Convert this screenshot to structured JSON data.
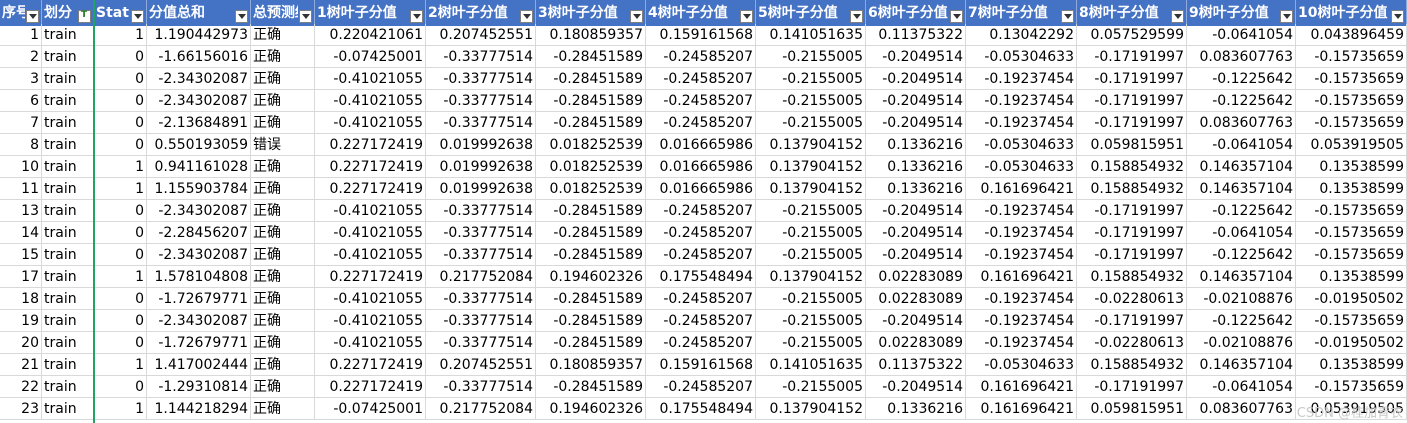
{
  "headers": [
    "序号",
    "划分",
    "Statu",
    "分值总和",
    "总预测结",
    "1树叶子分值",
    "2树叶子分值",
    "3树叶子分值",
    "4树叶子分值",
    "5树叶子分值",
    "6树叶子分值",
    "7树叶子分值",
    "8树叶子分值",
    "9树叶子分值",
    "10树叶子分值"
  ],
  "rows": [
    [
      "1",
      "train",
      "1",
      "1.190442973",
      "正确",
      "0.220421061",
      "0.207452551",
      "0.180859357",
      "0.159161568",
      "0.141051635",
      "0.11375322",
      "0.13042292",
      "0.057529599",
      "-0.0641054",
      "0.043896459"
    ],
    [
      "2",
      "train",
      "0",
      "-1.66156016",
      "正确",
      "-0.07425001",
      "-0.33777514",
      "-0.28451589",
      "-0.24585207",
      "-0.2155005",
      "-0.2049514",
      "-0.05304633",
      "-0.17191997",
      "0.083607763",
      "-0.15735659"
    ],
    [
      "3",
      "train",
      "0",
      "-2.34302087",
      "正确",
      "-0.41021055",
      "-0.33777514",
      "-0.28451589",
      "-0.24585207",
      "-0.2155005",
      "-0.2049514",
      "-0.19237454",
      "-0.17191997",
      "-0.1225642",
      "-0.15735659"
    ],
    [
      "6",
      "train",
      "0",
      "-2.34302087",
      "正确",
      "-0.41021055",
      "-0.33777514",
      "-0.28451589",
      "-0.24585207",
      "-0.2155005",
      "-0.2049514",
      "-0.19237454",
      "-0.17191997",
      "-0.1225642",
      "-0.15735659"
    ],
    [
      "7",
      "train",
      "0",
      "-2.13684891",
      "正确",
      "-0.41021055",
      "-0.33777514",
      "-0.28451589",
      "-0.24585207",
      "-0.2155005",
      "-0.2049514",
      "-0.19237454",
      "-0.17191997",
      "0.083607763",
      "-0.15735659"
    ],
    [
      "8",
      "train",
      "0",
      "0.550193059",
      "错误",
      "0.227172419",
      "0.019992638",
      "0.018252539",
      "0.016665986",
      "0.137904152",
      "0.1336216",
      "-0.05304633",
      "0.059815951",
      "-0.0641054",
      "0.053919505"
    ],
    [
      "10",
      "train",
      "1",
      "0.941161028",
      "正确",
      "0.227172419",
      "0.019992638",
      "0.018252539",
      "0.016665986",
      "0.137904152",
      "0.1336216",
      "-0.05304633",
      "0.158854932",
      "0.146357104",
      "0.13538599"
    ],
    [
      "11",
      "train",
      "1",
      "1.155903784",
      "正确",
      "0.227172419",
      "0.019992638",
      "0.018252539",
      "0.016665986",
      "0.137904152",
      "0.1336216",
      "0.161696421",
      "0.158854932",
      "0.146357104",
      "0.13538599"
    ],
    [
      "13",
      "train",
      "0",
      "-2.34302087",
      "正确",
      "-0.41021055",
      "-0.33777514",
      "-0.28451589",
      "-0.24585207",
      "-0.2155005",
      "-0.2049514",
      "-0.19237454",
      "-0.17191997",
      "-0.1225642",
      "-0.15735659"
    ],
    [
      "14",
      "train",
      "0",
      "-2.28456207",
      "正确",
      "-0.41021055",
      "-0.33777514",
      "-0.28451589",
      "-0.24585207",
      "-0.2155005",
      "-0.2049514",
      "-0.19237454",
      "-0.17191997",
      "-0.0641054",
      "-0.15735659"
    ],
    [
      "15",
      "train",
      "0",
      "-2.34302087",
      "正确",
      "-0.41021055",
      "-0.33777514",
      "-0.28451589",
      "-0.24585207",
      "-0.2155005",
      "-0.2049514",
      "-0.19237454",
      "-0.17191997",
      "-0.1225642",
      "-0.15735659"
    ],
    [
      "17",
      "train",
      "1",
      "1.578104808",
      "正确",
      "0.227172419",
      "0.217752084",
      "0.194602326",
      "0.175548494",
      "0.137904152",
      "0.02283089",
      "0.161696421",
      "0.158854932",
      "0.146357104",
      "0.13538599"
    ],
    [
      "18",
      "train",
      "0",
      "-1.72679771",
      "正确",
      "-0.41021055",
      "-0.33777514",
      "-0.28451589",
      "-0.24585207",
      "-0.2155005",
      "0.02283089",
      "-0.19237454",
      "-0.02280613",
      "-0.02108876",
      "-0.01950502"
    ],
    [
      "19",
      "train",
      "0",
      "-2.34302087",
      "正确",
      "-0.41021055",
      "-0.33777514",
      "-0.28451589",
      "-0.24585207",
      "-0.2155005",
      "-0.2049514",
      "-0.19237454",
      "-0.17191997",
      "-0.1225642",
      "-0.15735659"
    ],
    [
      "20",
      "train",
      "0",
      "-1.72679771",
      "正确",
      "-0.41021055",
      "-0.33777514",
      "-0.28451589",
      "-0.24585207",
      "-0.2155005",
      "0.02283089",
      "-0.19237454",
      "-0.02280613",
      "-0.02108876",
      "-0.01950502"
    ],
    [
      "21",
      "train",
      "1",
      "1.417002444",
      "正确",
      "0.227172419",
      "0.207452551",
      "0.180859357",
      "0.159161568",
      "0.141051635",
      "0.11375322",
      "-0.05304633",
      "0.158854932",
      "0.146357104",
      "0.13538599"
    ],
    [
      "22",
      "train",
      "0",
      "-1.29310814",
      "正确",
      "0.227172419",
      "-0.33777514",
      "-0.28451589",
      "-0.24585207",
      "-0.2155005",
      "-0.2049514",
      "0.161696421",
      "-0.17191997",
      "-0.0641054",
      "-0.15735659"
    ],
    [
      "23",
      "train",
      "1",
      "1.144218294",
      "正确",
      "-0.07425001",
      "0.217752084",
      "0.194602326",
      "0.175548494",
      "0.137904152",
      "0.1336216",
      "0.161696421",
      "0.059815951",
      "0.083607763",
      "0.053919505"
    ]
  ],
  "watermark": "CSDN @桂加青衣",
  "colors": {
    "header_bg": "#4472C4",
    "header_text": "#ffffff",
    "filter_indicator": "#21A366"
  },
  "icons": {
    "dropdown": "filter-dropdown-icon",
    "active_filter": "active-filter-icon"
  }
}
